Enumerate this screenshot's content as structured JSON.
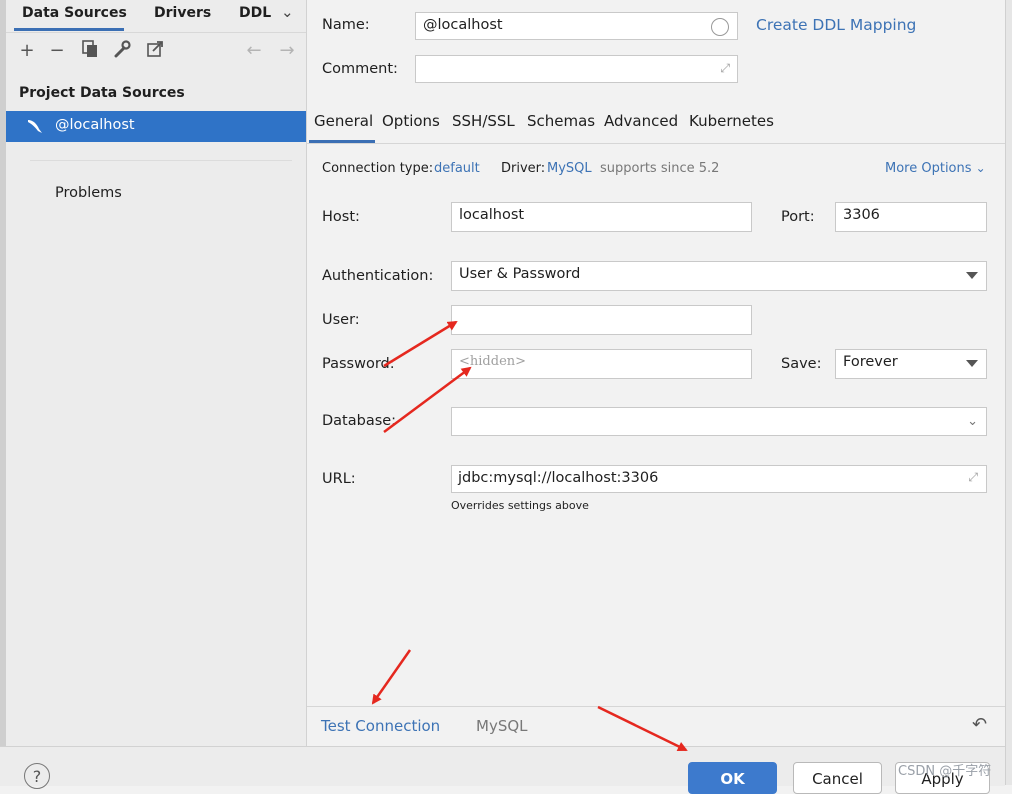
{
  "left_panel": {
    "tabs": [
      "Data Sources",
      "Drivers",
      "DDL"
    ],
    "toolbar": [
      "add-icon",
      "remove-icon",
      "duplicate-icon",
      "settings-icon",
      "export-icon",
      "back-arrow-icon",
      "forward-arrow-icon"
    ],
    "section_header": "Project Data Sources",
    "data_source": "@localhost",
    "problems": "Problems"
  },
  "header": {
    "name_label": "Name:",
    "name_value": "@localhost",
    "comment_label": "Comment:",
    "create_ddl_link": "Create DDL Mapping"
  },
  "tabs": [
    "General",
    "Options",
    "SSH/SSL",
    "Schemas",
    "Advanced",
    "Kubernetes"
  ],
  "info": {
    "connection_type_label": "Connection type:",
    "connection_type_value": "default",
    "driver_label": "Driver:",
    "driver_value": "MySQL",
    "driver_note": "supports since 5.2",
    "more_options": "More Options"
  },
  "form": {
    "host_label": "Host:",
    "host_value": "localhost",
    "port_label": "Port:",
    "port_value": "3306",
    "auth_label": "Authentication:",
    "auth_value": "User & Password",
    "user_label": "User:",
    "user_value": "",
    "password_label": "Password:",
    "password_placeholder": "<hidden>",
    "save_label": "Save:",
    "save_value": "Forever",
    "database_label": "Database:",
    "database_value": "",
    "url_label": "URL:",
    "url_value": "jdbc:mysql://localhost:3306",
    "url_note": "Overrides settings above"
  },
  "bottom_bar": {
    "test_connection": "Test Connection",
    "driver_name": "MySQL"
  },
  "footer": {
    "help": "?",
    "ok": "OK",
    "cancel": "Cancel",
    "apply": "Apply"
  },
  "watermark": "CSDN @千字符",
  "colors": {
    "accent": "#3b6fb4",
    "selection": "#2f73c7",
    "link": "#3d73b5",
    "annotation_arrow": "#e5281f"
  }
}
